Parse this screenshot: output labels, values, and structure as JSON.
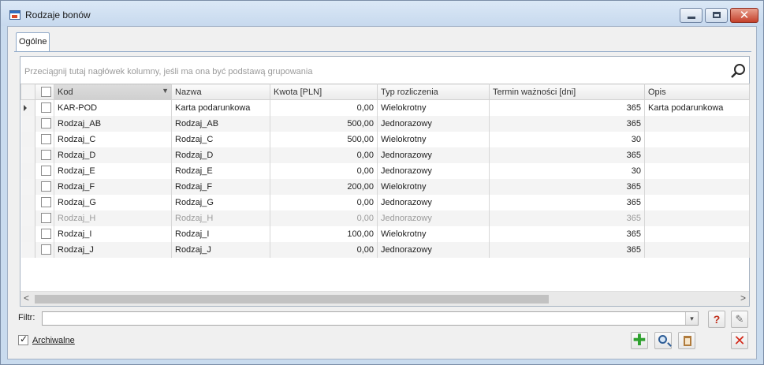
{
  "window": {
    "title": "Rodzaje bonów",
    "close_glyph": "✕"
  },
  "tabs": [
    {
      "label": "Ogólne"
    }
  ],
  "grid": {
    "group_hint": "Przeciągnij tutaj nagłówek kolumny, jeśli ma ona być podstawą grupowania",
    "columns": {
      "kod": "Kod",
      "nazwa": "Nazwa",
      "kwota": "Kwota [PLN]",
      "typ": "Typ rozliczenia",
      "termin": "Termin ważności [dni]",
      "opis": "Opis"
    },
    "rows": [
      {
        "kod": "KAR-POD",
        "nazwa": "Karta podarunkowa",
        "kwota": "0,00",
        "typ": "Wielokrotny",
        "termin": "365",
        "opis": "Karta podarunkowa"
      },
      {
        "kod": "Rodzaj_AB",
        "nazwa": "Rodzaj_AB",
        "kwota": "500,00",
        "typ": "Jednorazowy",
        "termin": "365",
        "opis": ""
      },
      {
        "kod": "Rodzaj_C",
        "nazwa": "Rodzaj_C",
        "kwota": "500,00",
        "typ": "Wielokrotny",
        "termin": "30",
        "opis": ""
      },
      {
        "kod": "Rodzaj_D",
        "nazwa": "Rodzaj_D",
        "kwota": "0,00",
        "typ": "Jednorazowy",
        "termin": "365",
        "opis": ""
      },
      {
        "kod": "Rodzaj_E",
        "nazwa": "Rodzaj_E",
        "kwota": "0,00",
        "typ": "Jednorazowy",
        "termin": "30",
        "opis": ""
      },
      {
        "kod": "Rodzaj_F",
        "nazwa": "Rodzaj_F",
        "kwota": "200,00",
        "typ": "Wielokrotny",
        "termin": "365",
        "opis": ""
      },
      {
        "kod": "Rodzaj_G",
        "nazwa": "Rodzaj_G",
        "kwota": "0,00",
        "typ": "Jednorazowy",
        "termin": "365",
        "opis": ""
      },
      {
        "kod": "Rodzaj_H",
        "nazwa": "Rodzaj_H",
        "kwota": "0,00",
        "typ": "Jednorazowy",
        "termin": "365",
        "opis": ""
      },
      {
        "kod": "Rodzaj_I",
        "nazwa": "Rodzaj_I",
        "kwota": "100,00",
        "typ": "Wielokrotny",
        "termin": "365",
        "opis": ""
      },
      {
        "kod": "Rodzaj_J",
        "nazwa": "Rodzaj_J",
        "kwota": "0,00",
        "typ": "Jednorazowy",
        "termin": "365",
        "opis": ""
      }
    ]
  },
  "scrollbar": {
    "left_arrow": "<",
    "right_arrow": ">"
  },
  "filter": {
    "label": "Filtr:",
    "value": "",
    "dropdown_glyph": "▾"
  },
  "buttons": {
    "help_glyph": "?",
    "wrench_glyph": "✎",
    "add_glyph": "✚",
    "cancel_glyph": "✕"
  },
  "archiwalne": {
    "label": "Archiwalne",
    "checked": true,
    "check_glyph": "✓"
  }
}
